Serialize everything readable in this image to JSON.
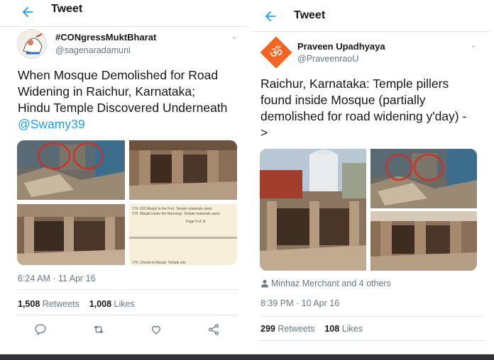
{
  "left": {
    "topbar_title": "Tweet",
    "author_name": "#CONgressMuktBharat",
    "author_handle": "@sagenaradamuni",
    "text_lines": [
      "When Mosque Demolished for Road",
      "Widening in Raichur, Karnataka;",
      "Hindu Temple Discovered Underneath"
    ],
    "mention": "@Swamy39",
    "doc_lines": [
      "174.   630 Masjid in the Fort. Temple materials used.",
      "175.   Masjid inside the Naurangi. Temple materials used."
    ],
    "doc_page": "Page 9 of 11",
    "doc_footer": "176.   Chowk-ki-Masjid. Temple site",
    "timestamp": "6:24 AM · 11 Apr 16",
    "retweets_count": "1,508",
    "retweets_label": "Retweets",
    "likes_count": "1,008",
    "likes_label": "Likes"
  },
  "right": {
    "topbar_title": "Tweet",
    "author_name": "Praveen Upadhyaya",
    "author_handle": "@PraveenraoU",
    "text_lines": [
      "Raichur, Karnataka: Temple pillers",
      "found inside Mosque (partially",
      "demolished for road widening y'day) -",
      ">"
    ],
    "social_context": "Minhaz Merchant and 4 others",
    "timestamp": "8:39 PM · 10 Apr 16",
    "retweets_count": "299",
    "retweets_label": "Retweets",
    "likes_count": "108",
    "likes_label": "Likes"
  },
  "colors": {
    "accent": "#1da1f2",
    "text": "#14171a",
    "muted": "#657786",
    "divider": "#e1e8ed",
    "avatar_orange": "#f26522",
    "rubble": "#8a6e55"
  },
  "icons": [
    "back-arrow-icon",
    "chevron-down-icon",
    "reply-icon",
    "retweet-icon",
    "like-icon",
    "share-icon",
    "person-icon",
    "om-icon"
  ]
}
